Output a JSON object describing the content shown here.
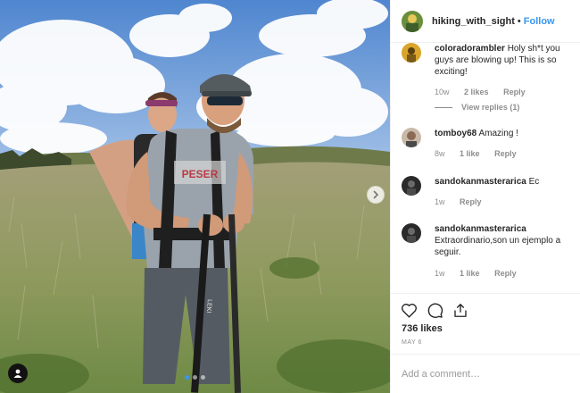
{
  "post": {
    "username": "hiking_with_sight",
    "separator": "•",
    "follow_label": "Follow",
    "likes": "736 likes",
    "date": "MAY 6",
    "add_comment_placeholder": "Add a comment…"
  },
  "photo": {
    "pole_text": "LEKI",
    "shirt_text": "PESER"
  },
  "comments": [
    {
      "username": "coloradorambler",
      "text": "Holy sh*t you guys are blowing up! This is so exciting!",
      "time": "10w",
      "likes": "2 likes",
      "reply": "Reply",
      "view_replies": "View replies (1)"
    },
    {
      "username": "tomboy68",
      "text": "Amazing !",
      "time": "8w",
      "likes": "1 like",
      "reply": "Reply"
    },
    {
      "username": "sandokanmasterarica",
      "text": "Ec",
      "time": "1w",
      "reply": "Reply"
    },
    {
      "username": "sandokanmasterarica",
      "text": "Extraordinario,son un ejemplo a seguir.",
      "time": "1w",
      "likes": "1 like",
      "reply": "Reply"
    }
  ],
  "icons": {
    "like": "heart-icon",
    "comment": "comment-icon",
    "share": "share-icon",
    "next": "chevron-right-icon",
    "tagged_users": "user-tag-icon"
  },
  "colors": {
    "accent": "#3897f0",
    "muted": "#8e8e8e",
    "text": "#262626"
  }
}
